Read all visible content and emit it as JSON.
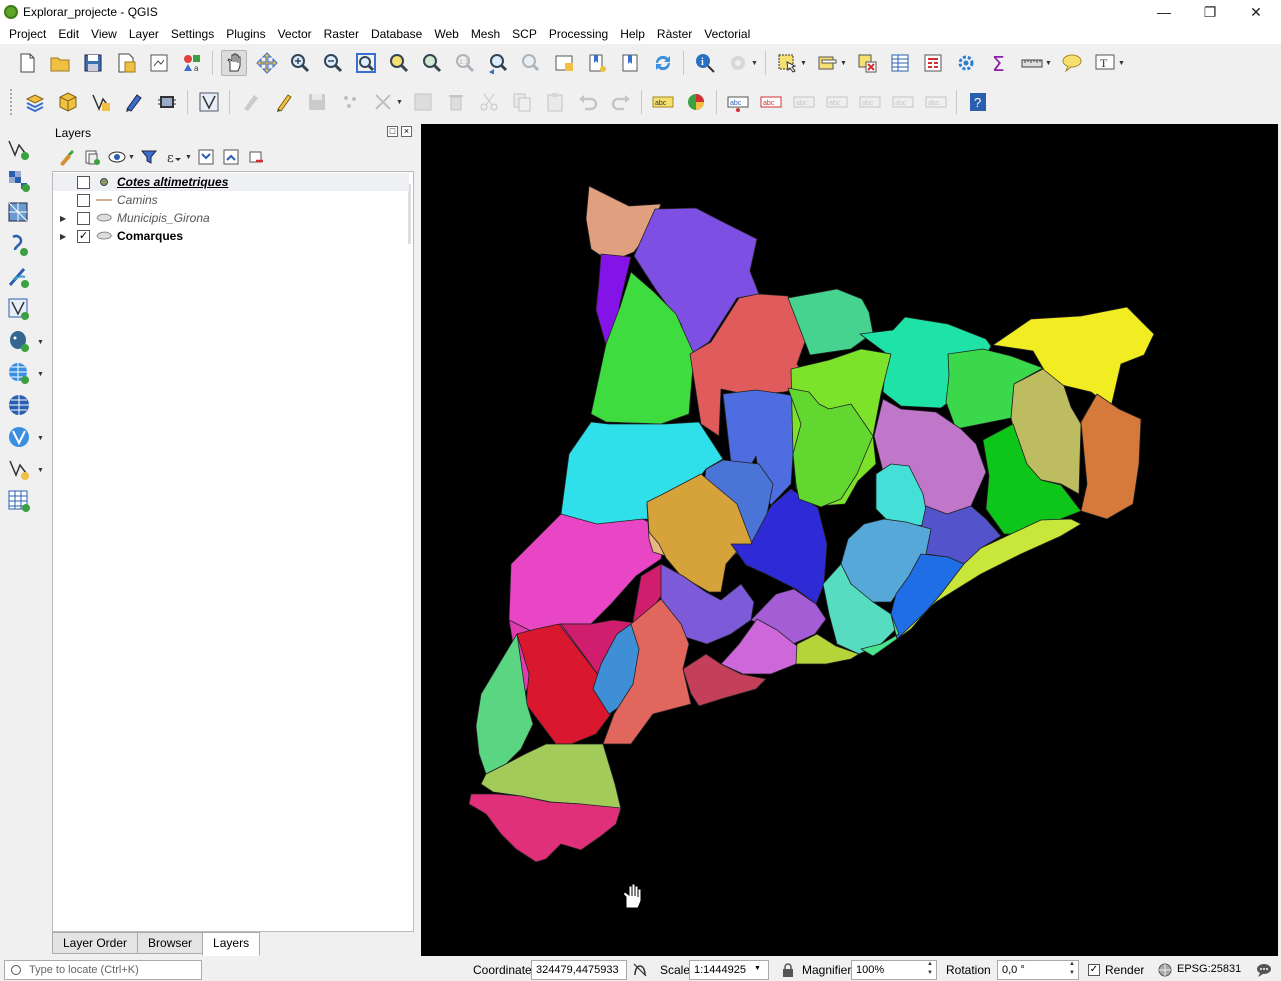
{
  "window": {
    "title": "Explorar_projecte - QGIS"
  },
  "menu": [
    "Project",
    "Edit",
    "View",
    "Layer",
    "Settings",
    "Plugins",
    "Vector",
    "Raster",
    "Database",
    "Web",
    "Mesh",
    "SCP",
    "Processing",
    "Help",
    "Ràster",
    "Vectorial"
  ],
  "panel": {
    "title": "Layers",
    "layers": [
      {
        "name": "Cotes altimetriques",
        "checked": false,
        "style": "bolditalic",
        "symbol": "point"
      },
      {
        "name": "Camins",
        "checked": false,
        "style": "italic",
        "symbol": "line"
      },
      {
        "name": "Municipis_Girona",
        "checked": false,
        "style": "italic",
        "symbol": "polygon",
        "expandable": true
      },
      {
        "name": "Comarques",
        "checked": true,
        "style": "bold",
        "symbol": "polygon",
        "expandable": true
      }
    ],
    "tabs": [
      "Layer Order",
      "Browser",
      "Layers"
    ],
    "active_tab": "Layers"
  },
  "status": {
    "locator_placeholder": "Type to locate (Ctrl+K)",
    "coordinate_label": "Coordinate",
    "coordinate_value": "324479,4475933",
    "scale_label": "Scale",
    "scale_value": "1:1444925",
    "magnifier_label": "Magnifier",
    "magnifier_value": "100%",
    "rotation_label": "Rotation",
    "rotation_value": "0,0 °",
    "render_label": "Render",
    "render_checked": true,
    "crs": "EPSG:25831"
  },
  "colors": {
    "canvas_bg": "#000000",
    "region_colors": [
      "#e0a080",
      "#7e4fe3",
      "#8413e8",
      "#3fdc3f",
      "#e05c5c",
      "#45d38f",
      "#1fe3a6",
      "#f2ec22",
      "#3ad84a",
      "#2fdfe9",
      "#4d6de0",
      "#7ce32a",
      "#4a75d6",
      "#c177c9",
      "#bebc60",
      "#d57a3a",
      "#0ec61a",
      "#e846c5",
      "#e8b680",
      "#d6a23a",
      "#2e2ad6",
      "#62d730",
      "#44e0d8",
      "#5353cb",
      "#e03bb0",
      "#d01d6d",
      "#7c5ad8",
      "#55a8d8",
      "#56dcc0",
      "#1f6ee6",
      "#a55dd6",
      "#ce67da",
      "#b5d43a",
      "#47e68e",
      "#c9e63a",
      "#d9172e",
      "#3f8fd6",
      "#e0665e",
      "#c4405a",
      "#5ad683",
      "#a2cb5a",
      "#e0307a"
    ]
  },
  "icons": [
    "new-project-icon",
    "open-project-icon",
    "save-project-icon",
    "print-layout-icon",
    "layout-manager-icon",
    "style-manager-icon",
    "pan-icon",
    "pan-to-selection-icon",
    "zoom-in-icon",
    "zoom-out-icon",
    "zoom-full-icon",
    "zoom-to-selection-icon",
    "zoom-to-layer-icon",
    "zoom-native-icon",
    "zoom-last-icon",
    "zoom-next-icon",
    "new-map-view-icon",
    "new-bookmark-icon",
    "show-bookmarks-icon",
    "refresh-icon",
    "identify-icon",
    "run-action-icon",
    "select-features-icon",
    "select-by-value-icon",
    "deselect-icon",
    "attribute-table-icon",
    "field-calculator-icon",
    "processing-toolbox-icon",
    "statistics-icon",
    "measure-icon",
    "map-tips-icon",
    "text-annotation-icon"
  ]
}
